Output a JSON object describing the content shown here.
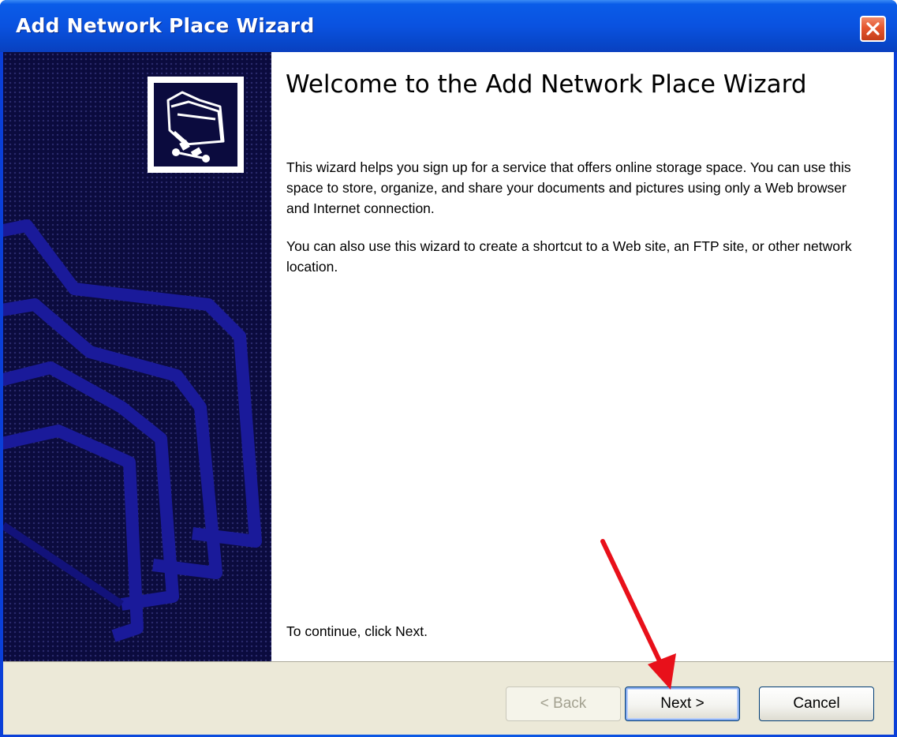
{
  "window": {
    "title": "Add Network Place Wizard",
    "close_icon": "close-icon"
  },
  "welcome": {
    "heading": "Welcome to the Add Network Place Wizard",
    "paragraph1": "This wizard helps you sign up for a service that offers online storage space. You can use this space to store, organize, and share your documents and pictures using only a Web browser and Internet connection.",
    "paragraph2": "You can also use this wizard to create a shortcut to a Web site, an FTP site, or other network location.",
    "continue_hint": "To continue, click Next."
  },
  "buttons": {
    "back": "< Back",
    "next": "Next >",
    "cancel": "Cancel"
  },
  "icons": {
    "wizard": "network-folder-icon",
    "annotation": "red-arrow-icon"
  },
  "colors": {
    "titlebar": "#0a52e0",
    "sidebar": "#0b0b3e",
    "button_bar": "#ece9d8",
    "arrow": "#e8101a"
  }
}
